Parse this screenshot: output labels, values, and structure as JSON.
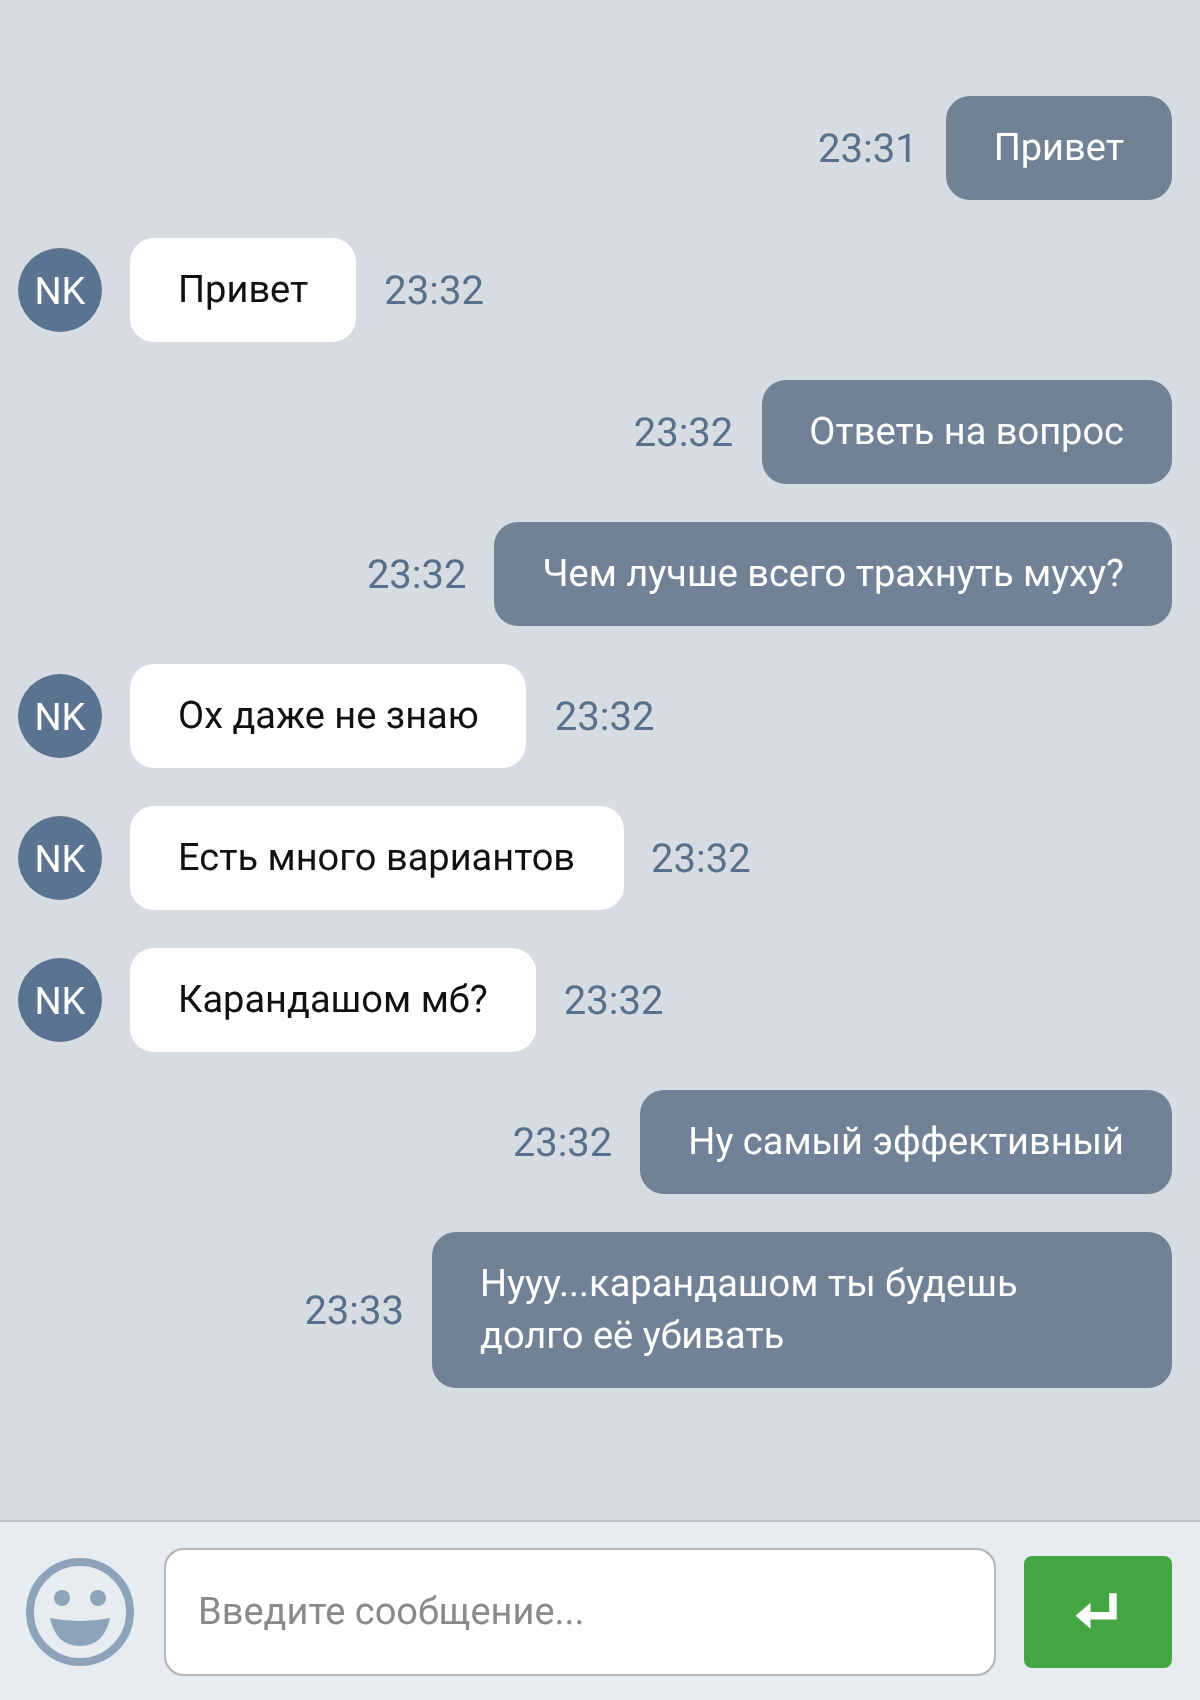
{
  "messages": [
    {
      "kind": "outgoing",
      "text": "Привет",
      "time": "23:31"
    },
    {
      "kind": "incoming",
      "avatar": "NK",
      "text": "Привет",
      "time": "23:32"
    },
    {
      "kind": "outgoing",
      "text": "Ответь на вопрос",
      "time": "23:32"
    },
    {
      "kind": "outgoing",
      "text": "Чем лучше всего трахнуть муху?",
      "time": "23:32"
    },
    {
      "kind": "incoming",
      "avatar": "NK",
      "text": "Ох даже не знаю",
      "time": "23:32"
    },
    {
      "kind": "incoming",
      "avatar": "NK",
      "text": "Есть много вариантов",
      "time": "23:32"
    },
    {
      "kind": "incoming",
      "avatar": "NK",
      "text": "Карандашом мб?",
      "time": "23:32"
    },
    {
      "kind": "outgoing",
      "text": "Ну самый эффективный",
      "time": "23:32"
    },
    {
      "kind": "outgoing",
      "text": "Нууу...карандашом ты будешь долго её убивать",
      "time": "23:33"
    }
  ],
  "composer": {
    "placeholder": "Введите сообщение..."
  }
}
